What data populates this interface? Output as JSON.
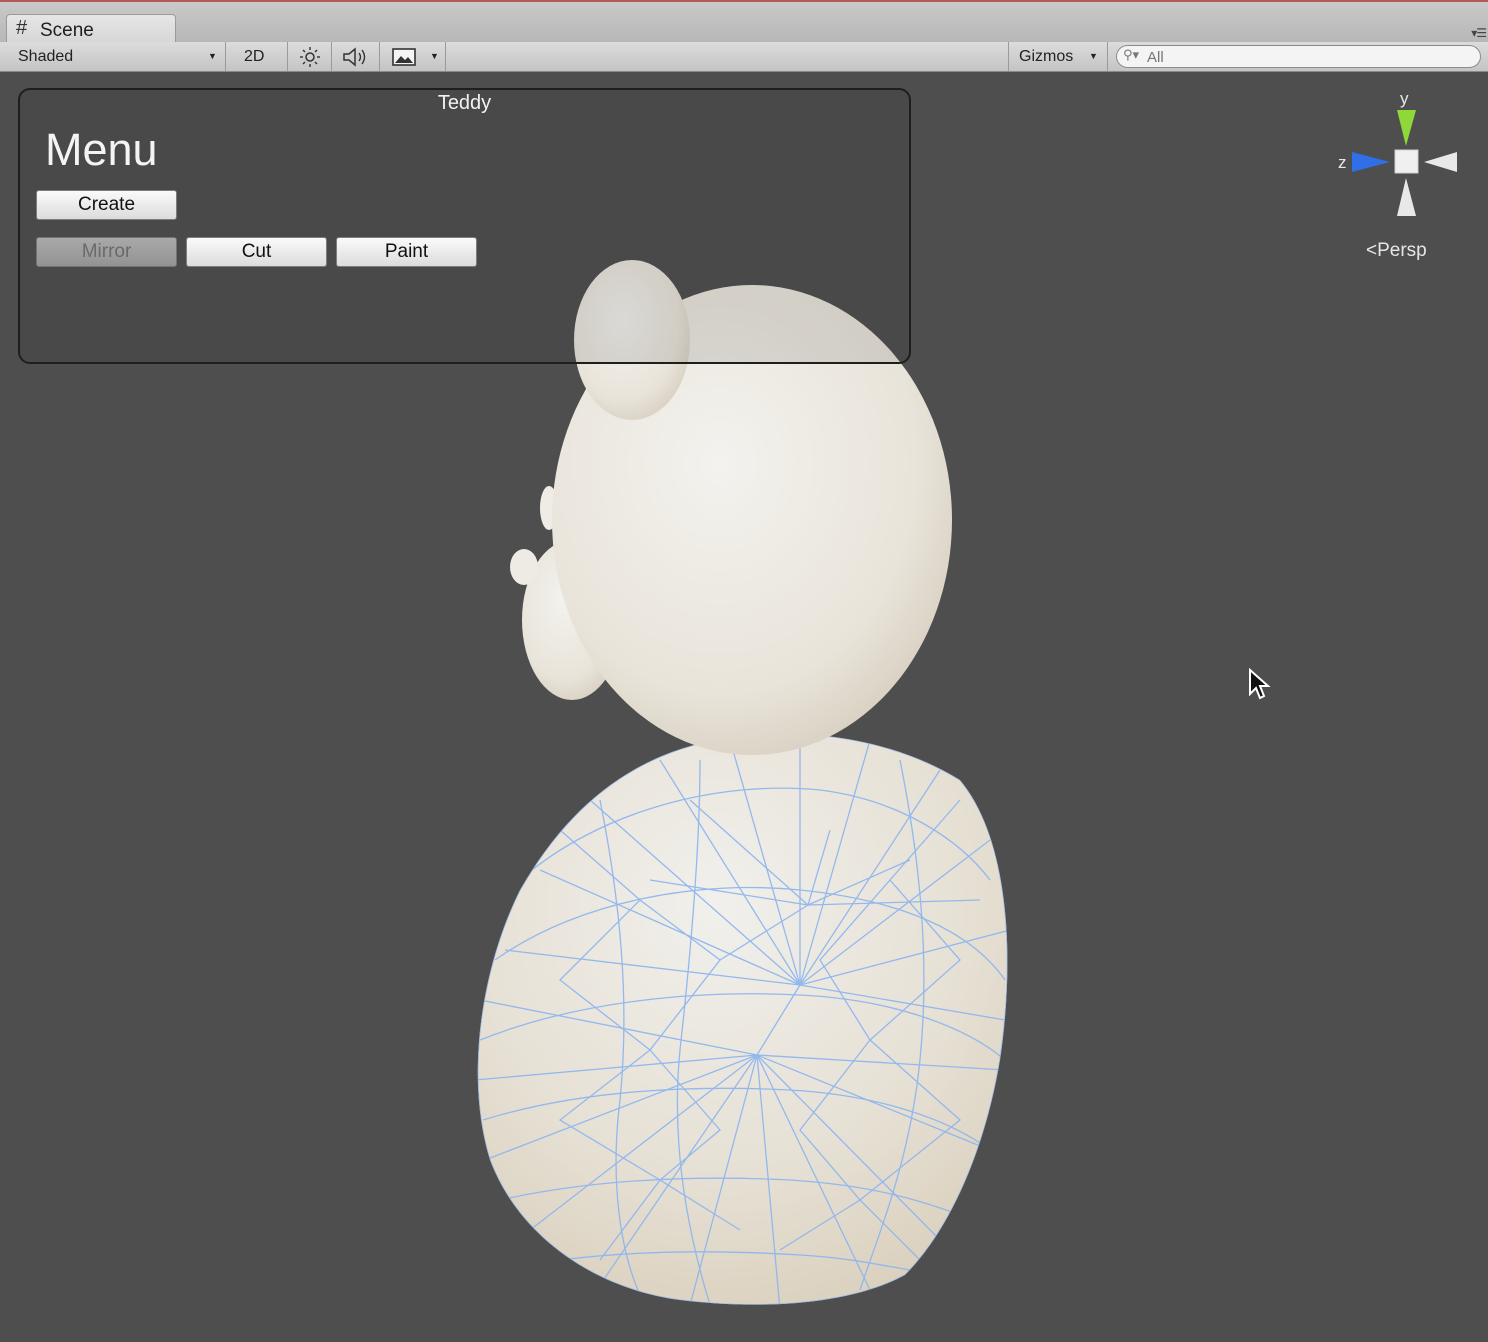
{
  "tab": {
    "label": "Scene"
  },
  "toolbar": {
    "shading_mode": "Shaded",
    "two_d_label": "2D",
    "gizmos_label": "Gizmos",
    "search_placeholder": "All"
  },
  "gui_window": {
    "title": "Teddy",
    "heading": "Menu",
    "buttons": {
      "create": "Create",
      "mirror": "Mirror",
      "cut": "Cut",
      "paint": "Paint"
    },
    "mirror_enabled": false
  },
  "gizmo": {
    "y_label": "y",
    "z_label": "z",
    "projection": "Persp",
    "colors": {
      "y": "#8fd83a",
      "z": "#2f6fe8",
      "x": "#e8e8e8"
    }
  },
  "icons": {
    "scene_tab": "hash-icon",
    "lighting": "sun-icon",
    "audio": "speaker-icon",
    "effects": "image-icon",
    "search": "search-icon",
    "panel_menu": "menu-icon",
    "pointer": "cursor-icon"
  },
  "colors": {
    "viewport_background": "#4e4e4e",
    "bear_surface": "#ece8df",
    "wireframe": "#8fb6ef"
  }
}
